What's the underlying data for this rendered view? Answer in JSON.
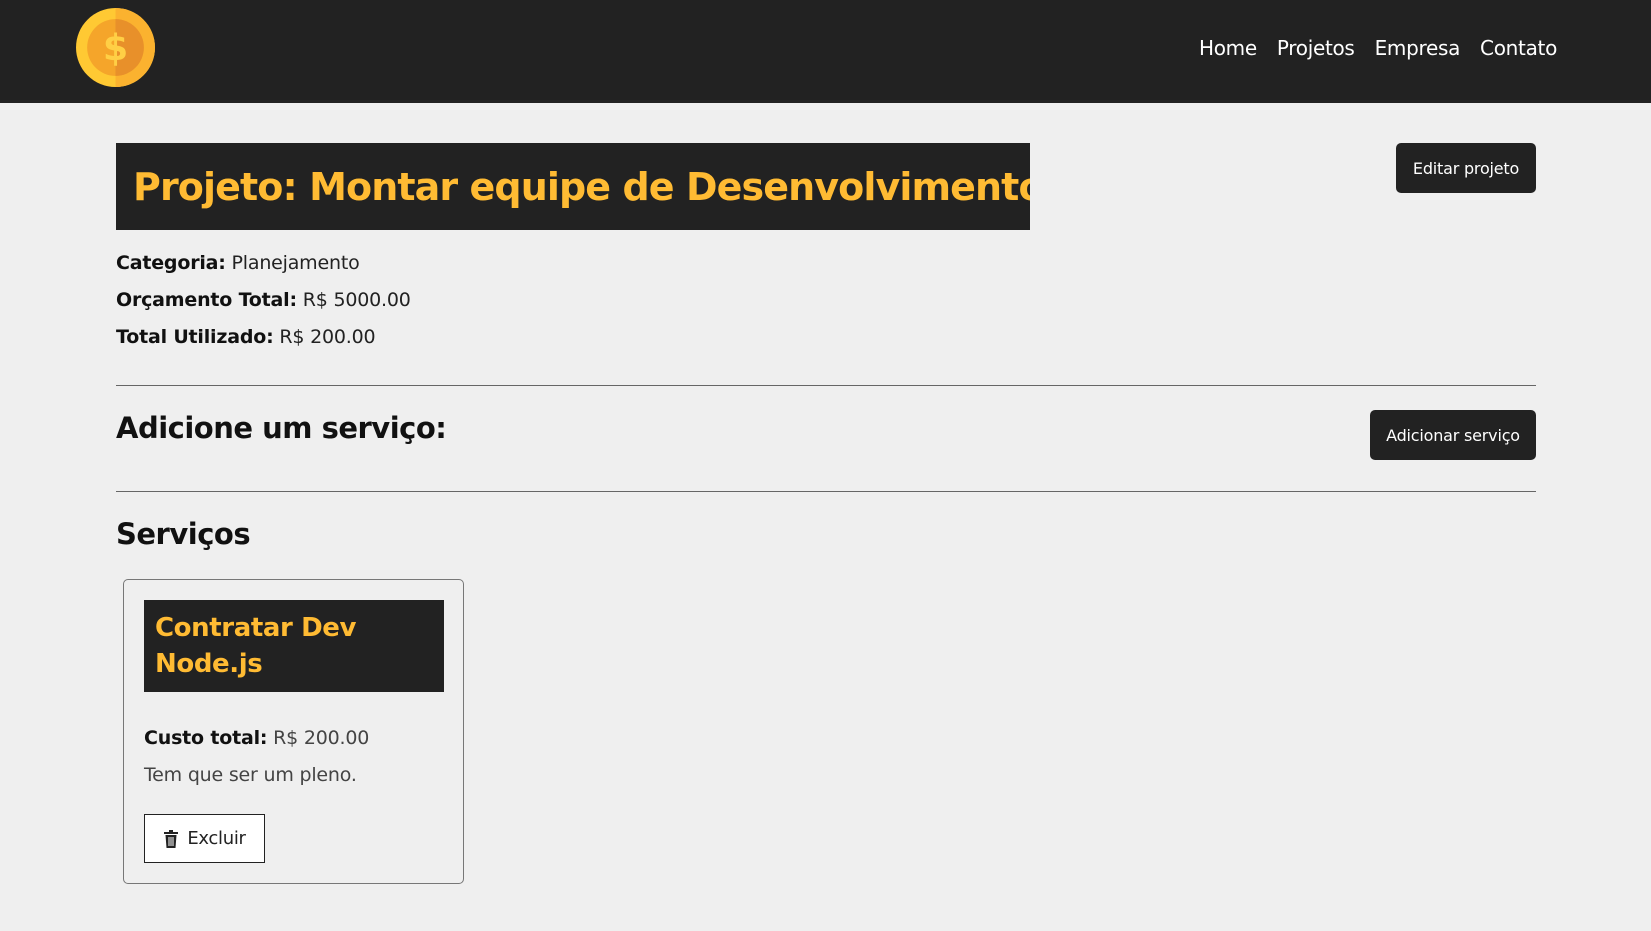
{
  "nav": {
    "logo_icon": "dollar-coin-icon",
    "links": [
      "Home",
      "Projetos",
      "Empresa",
      "Contato"
    ]
  },
  "project": {
    "title": "Projeto: Montar equipe de Desenvolvimento",
    "edit_label": "Editar projeto",
    "category_label": "Categoria:",
    "category_value": "Planejamento",
    "budget_label": "Orçamento Total:",
    "budget_value": "R$ 5000.00",
    "used_label": "Total Utilizado:",
    "used_value": "R$ 200.00"
  },
  "add_service": {
    "heading": "Adicione um serviço:",
    "button_label": "Adicionar serviço"
  },
  "services": {
    "heading": "Serviços",
    "items": [
      {
        "name": "Contratar Dev Node.js",
        "cost_label": "Custo total:",
        "cost_value": "R$ 200.00",
        "description": "Tem que ser um pleno.",
        "delete_label": "Excluir"
      }
    ]
  },
  "colors": {
    "accent": "#ffbb33",
    "dark": "#222222",
    "background": "#efefef"
  }
}
